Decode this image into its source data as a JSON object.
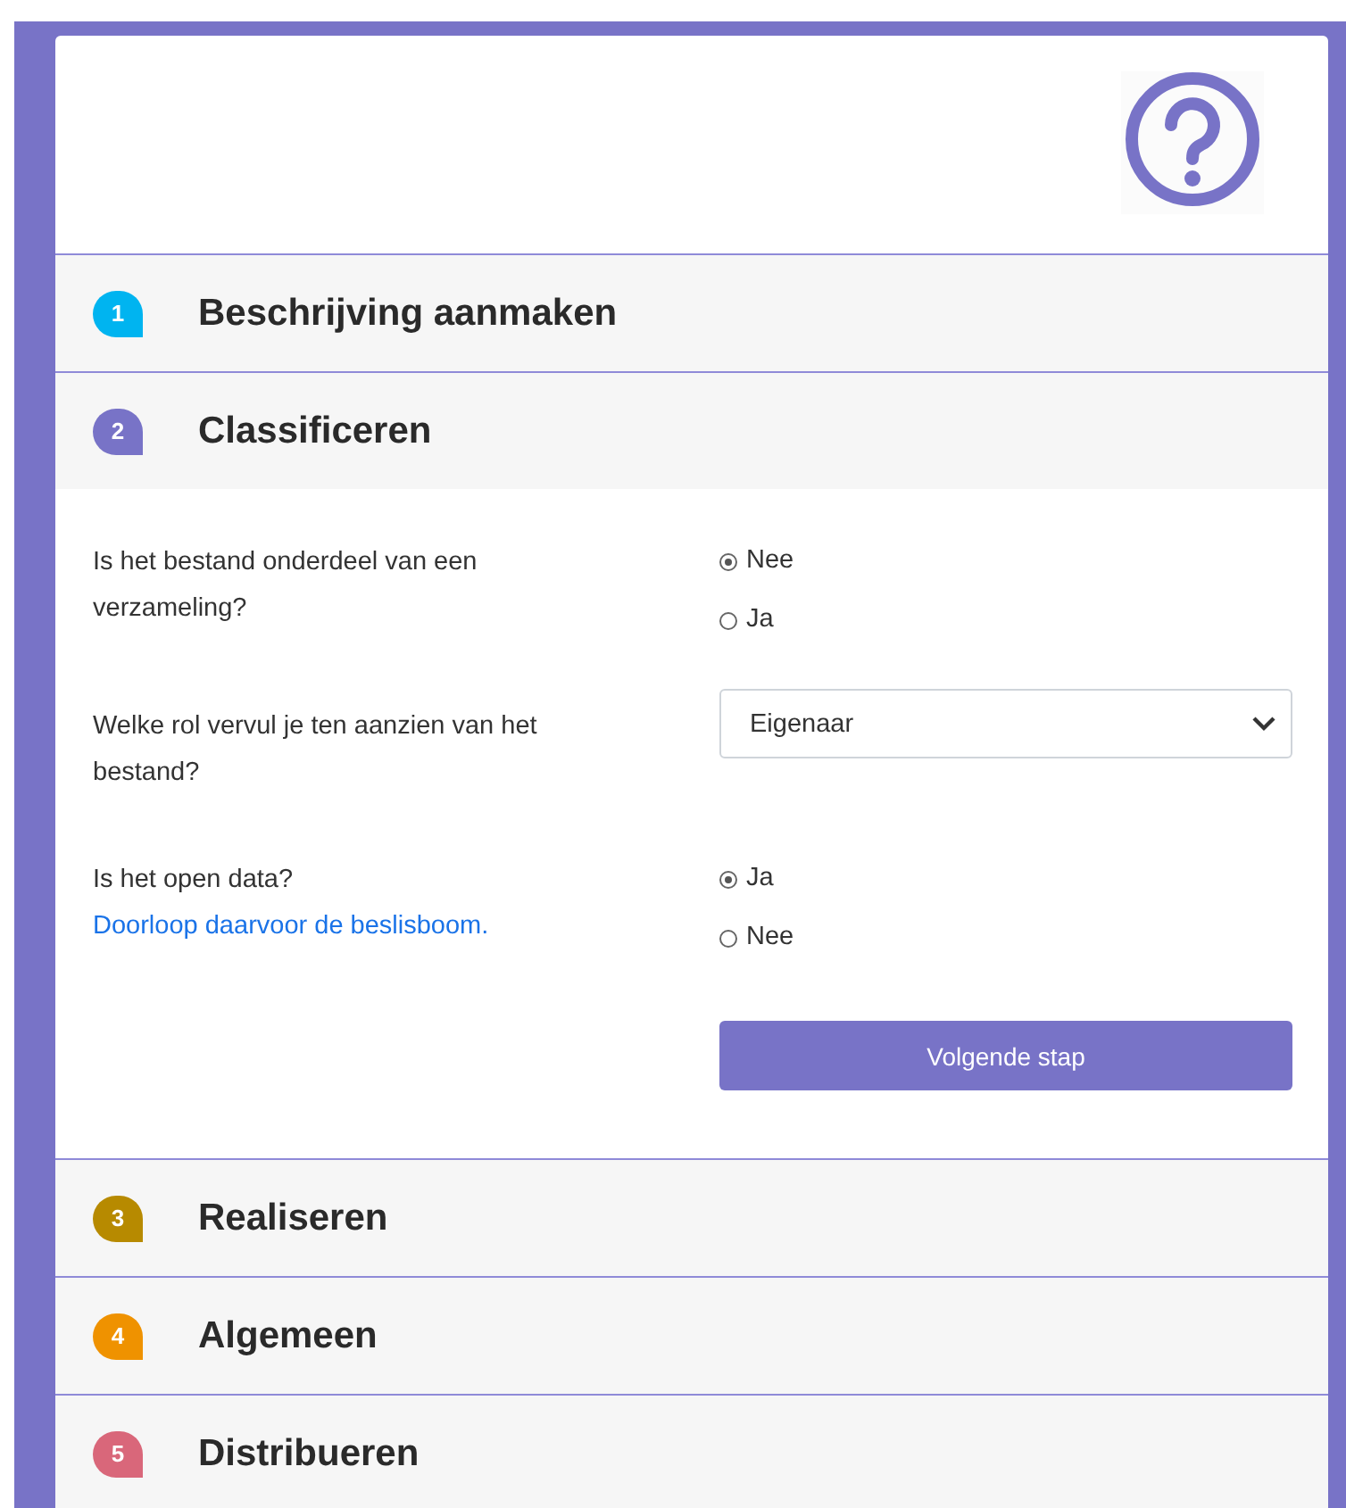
{
  "steps": [
    {
      "number": "1",
      "title": "Beschrijving aanmaken",
      "color": "#00b4f0"
    },
    {
      "number": "2",
      "title": "Classificeren",
      "color": "#7873c7",
      "questions": [
        {
          "kind": "radio",
          "question": "Is het bestand onderdeel van een verzameling?",
          "options": [
            {
              "label": "Nee",
              "selected": true
            },
            {
              "label": "Ja",
              "selected": false
            }
          ]
        },
        {
          "kind": "select",
          "question": "Welke rol vervul je ten aanzien van het bestand?",
          "value": "Eigenaar"
        },
        {
          "kind": "radio",
          "question": "Is het open data?",
          "link": "Doorloop daarvoor de beslisboom.",
          "options": [
            {
              "label": "Ja",
              "selected": true
            },
            {
              "label": "Nee",
              "selected": false
            }
          ]
        }
      ],
      "button": "Volgende stap"
    },
    {
      "number": "3",
      "title": "Realiseren",
      "color": "#b78a00"
    },
    {
      "number": "4",
      "title": "Algemeen",
      "color": "#ef9200"
    },
    {
      "number": "5",
      "title": "Distribueren",
      "color": "#d9677a"
    }
  ]
}
